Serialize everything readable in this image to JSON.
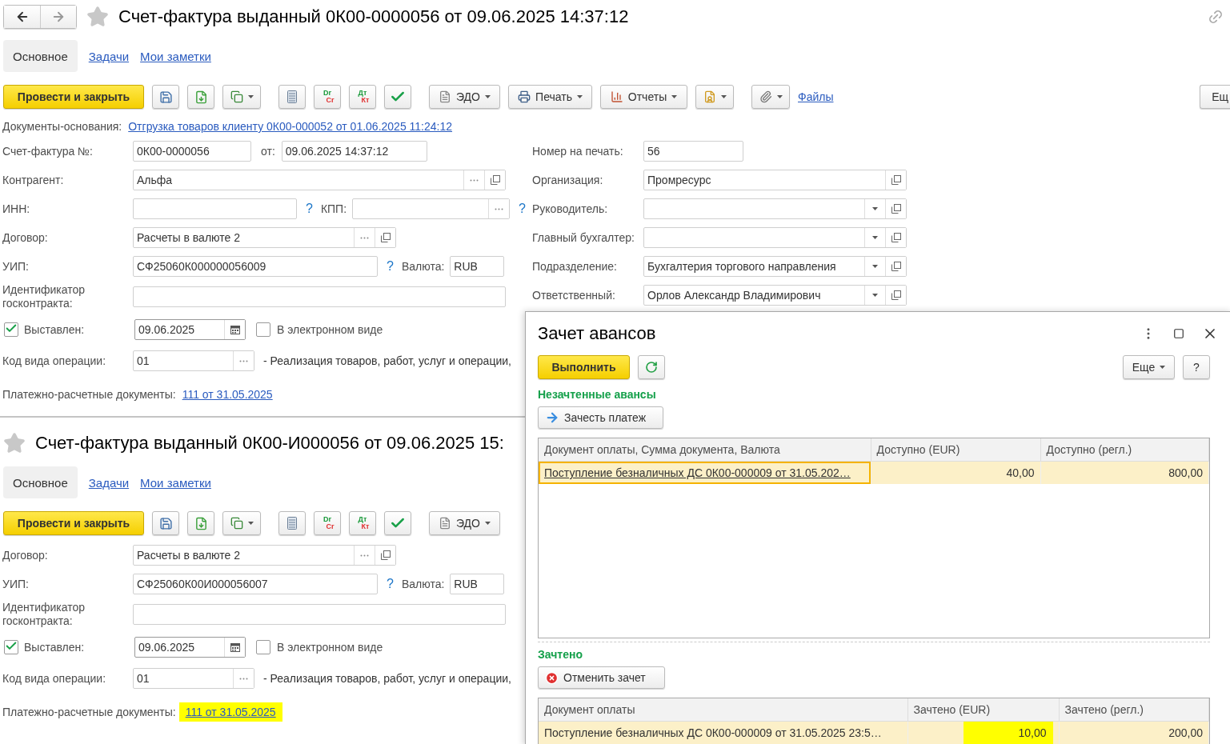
{
  "top_form": {
    "title": "Счет-фактура выданный 0К00-0000056 от 09.06.2025 14:37:12",
    "tabs": [
      {
        "label": "Основное",
        "selected": true
      },
      {
        "label": "Задачи",
        "selected": false
      },
      {
        "label": "Мои заметки",
        "selected": false
      }
    ],
    "toolbar": {
      "groups": [
        [
          {
            "kind": "primary",
            "label": "Провести и закрыть"
          },
          {
            "kind": "save"
          },
          {
            "kind": "post"
          },
          {
            "kind": "copy"
          }
        ],
        [
          {
            "kind": "list"
          },
          {
            "kind": "ledger",
            "top": "Dr",
            "bottom": "Cr"
          },
          {
            "kind": "ledger",
            "top": "Дт",
            "bottom": "Кт"
          },
          {
            "kind": "check"
          }
        ],
        [
          {
            "kind": "edo",
            "label": "ЭДО"
          },
          {
            "kind": "print",
            "label": "Печать"
          },
          {
            "kind": "reports",
            "label": "Отчеты"
          },
          {
            "kind": "attach"
          }
        ],
        [
          {
            "kind": "clip"
          },
          {
            "kind": "link",
            "label": "Файлы"
          }
        ]
      ],
      "more": "Ещ"
    },
    "basis": {
      "label": "Документы-основания:",
      "link": "Отгрузка товаров клиенту 0К00-000052 от 01.06.2025 11:24:12"
    },
    "left_rows": [
      {
        "kind": "number_date",
        "label": "Счет-фактура №:",
        "value": "0К00-0000056",
        "date_label": "от:",
        "date": "09.06.2025 14:37:12"
      },
      {
        "kind": "reference",
        "label": "Контрагент:",
        "value": "Альфа"
      },
      {
        "kind": "inn_kpp",
        "label": "ИНН:",
        "help": "?",
        "kpp_label": "КПП:",
        "kpp_help": "?"
      },
      {
        "kind": "contract",
        "label": "Договор:",
        "value": "Расчеты в валюте 2"
      },
      {
        "kind": "uip",
        "label": "УИП:",
        "value": "СФ25060К000000056009",
        "help": "?",
        "currency_label": "Валюта:",
        "currency": "RUB"
      },
      {
        "kind": "wide",
        "label": "Идентификатор госконтракта:"
      },
      {
        "kind": "issued",
        "label": "Выставлен:",
        "checked": true,
        "date": "09.06.2025",
        "electronic_label": "В электронном виде",
        "electronic": false
      },
      {
        "kind": "operation",
        "label": "Код вида операции:",
        "value": "01",
        "description": "- Реализация товаров, работ, услуг и операции,"
      },
      {
        "kind": "payment_docs",
        "label": "Платежно-расчетные документы:",
        "link": "111 от 31.05.2025",
        "highlighted": false
      }
    ],
    "right_rows": [
      {
        "kind": "plain",
        "label": "Номер на печать:",
        "value": "56"
      },
      {
        "kind": "open",
        "label": "Организация:",
        "value": "Промресурс"
      },
      {
        "kind": "choice",
        "label": "Руководитель:"
      },
      {
        "kind": "choice",
        "label": "Главный бухгалтер:"
      },
      {
        "kind": "choice",
        "label": "Подразделение:",
        "value": "Бухгалтерия торгового направления"
      },
      {
        "kind": "choice",
        "label": "Ответственный:",
        "value": "Орлов Александр Владимирович"
      }
    ]
  },
  "bottom_form": {
    "title": "Счет-фактура выданный 0К00-И000056 от 09.06.2025 15:",
    "tabs": [
      {
        "label": "Основное",
        "selected": true
      },
      {
        "label": "Задачи",
        "selected": false
      },
      {
        "label": "Мои заметки",
        "selected": false
      }
    ],
    "toolbar": {
      "groups": [
        [
          {
            "kind": "primary",
            "label": "Провести и закрыть"
          },
          {
            "kind": "save"
          },
          {
            "kind": "post"
          },
          {
            "kind": "copy"
          }
        ],
        [
          {
            "kind": "list"
          },
          {
            "kind": "ledger",
            "top": "Dr",
            "bottom": "Cr"
          },
          {
            "kind": "ledger",
            "top": "Дт",
            "bottom": "Кт"
          },
          {
            "kind": "check"
          }
        ],
        [
          {
            "kind": "edo",
            "label": "ЭДО"
          }
        ]
      ]
    },
    "left_rows": [
      {
        "kind": "contract",
        "label": "Договор:",
        "value": "Расчеты в валюте 2"
      },
      {
        "kind": "uip",
        "label": "УИП:",
        "value": "СФ25060К00И000056007",
        "help": "?",
        "currency_label": "Валюта:",
        "currency": "RUB"
      },
      {
        "kind": "wide",
        "label": "Идентификатор госконтракта:"
      },
      {
        "kind": "issued",
        "label": "Выставлен:",
        "checked": true,
        "date": "09.06.2025",
        "electronic_label": "В электронном виде",
        "electronic": false
      },
      {
        "kind": "operation",
        "label": "Код вида операции:",
        "value": "01",
        "description": "- Реализация товаров, работ, услуг и операции,"
      },
      {
        "kind": "payment_docs",
        "label": "Платежно-расчетные документы:",
        "link": "111 от 31.05.2025",
        "highlighted": true
      }
    ]
  },
  "dialog": {
    "title": "Зачет авансов",
    "run_button": "Выполнить",
    "more_button": "Еще",
    "help_button": "?",
    "unapplied": {
      "heading": "Незачтенные авансы",
      "button": "Зачесть платеж",
      "columns": [
        "Документ оплаты, Сумма документа, Валюта",
        "Доступно (EUR)",
        "Доступно (регл.)"
      ],
      "rows": [
        {
          "selected": true,
          "focused": true,
          "cells": [
            {
              "text": "Поступление безналичных ДС 0К00-000009 от 31.05.202…",
              "link": true,
              "highlighted": false
            },
            {
              "text": "40,00",
              "link": false,
              "highlighted": false
            },
            {
              "text": "800,00",
              "link": false,
              "highlighted": false
            }
          ]
        }
      ]
    },
    "applied": {
      "heading": "Зачтено",
      "button": "Отменить зачет",
      "columns": [
        "Документ оплаты",
        "Зачтено (EUR)",
        "Зачтено (регл.)"
      ],
      "rows": [
        {
          "selected": true,
          "focused": false,
          "cells": [
            {
              "text": "Поступление безналичных ДС 0К00-000009 от 31.05.2025 23:5…",
              "link": false,
              "highlighted": false
            },
            {
              "text": "10,00",
              "link": false,
              "highlighted": true
            },
            {
              "text": "200,00",
              "link": false,
              "highlighted": false
            }
          ]
        }
      ]
    }
  }
}
